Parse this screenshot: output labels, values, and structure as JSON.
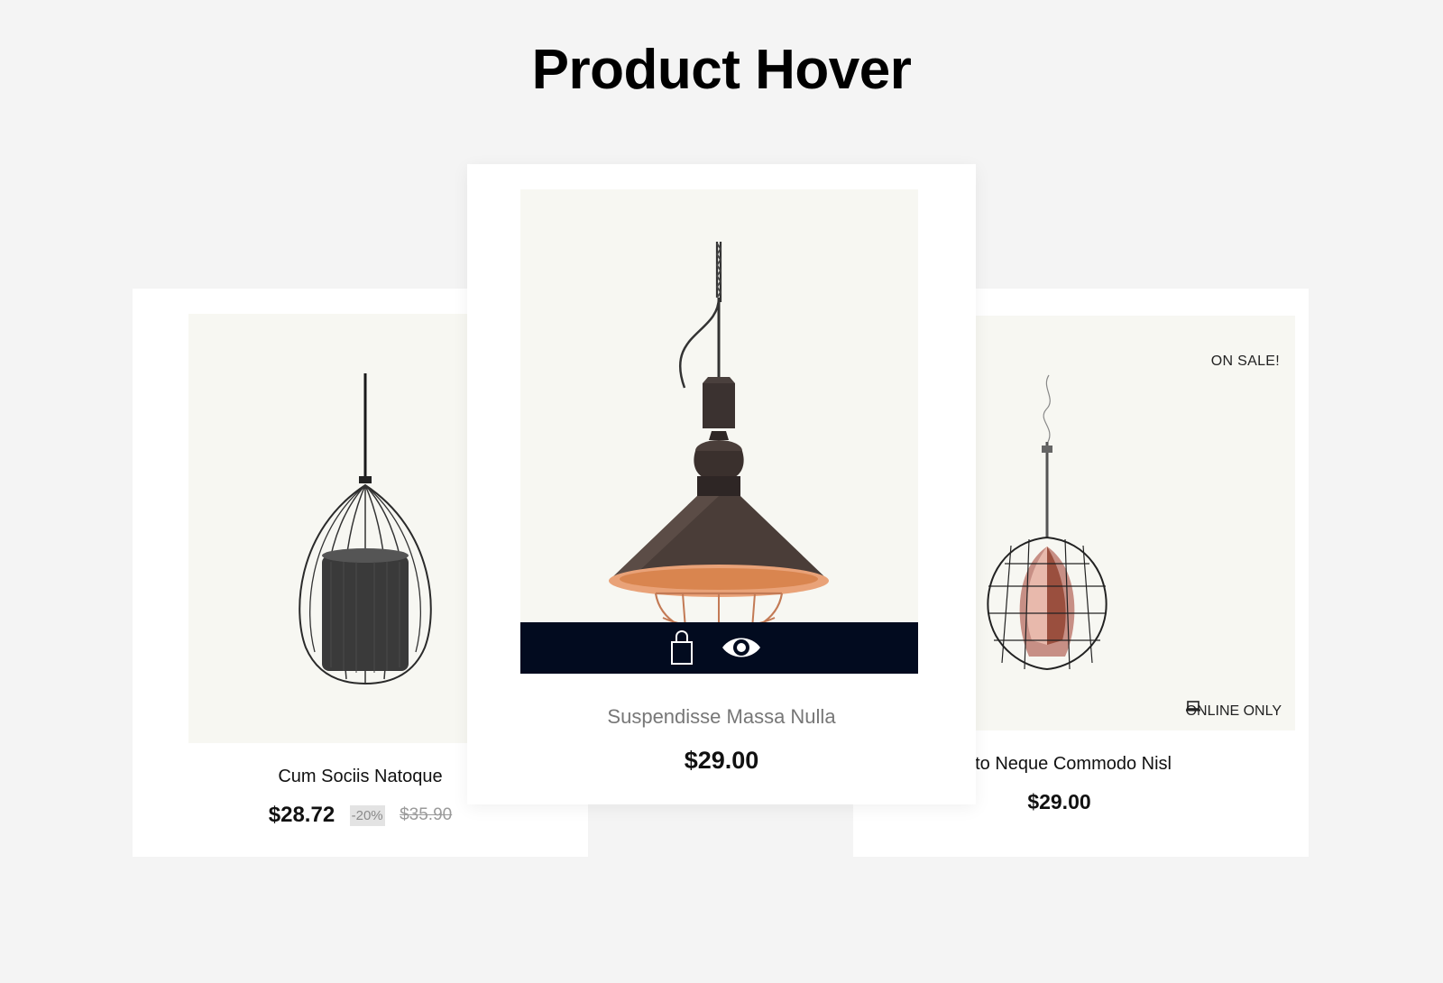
{
  "page": {
    "title": "Product Hover"
  },
  "products": [
    {
      "name": "Cum Sociis Natoque",
      "price": "$28.72",
      "discount": "-20%",
      "old_price": "$35.90"
    },
    {
      "name": "Suspendisse Massa Nulla",
      "price": "$29.00",
      "actions": [
        {
          "icon": "shopping-bag-icon"
        },
        {
          "icon": "eye-icon"
        }
      ]
    },
    {
      "name": "Justo Neque Commodo Nisl",
      "price": "$29.00",
      "flag_sale": "ON SALE!",
      "flag_online": "ONLINE ONLY",
      "flag_online_icon": "laptop-icon"
    }
  ],
  "colors": {
    "page_background": "#f4f4f4",
    "card_background": "#ffffff",
    "image_background": "#f7f7f2",
    "action_bar": "#020b1f",
    "discount_badge": "#e3e3e3"
  }
}
